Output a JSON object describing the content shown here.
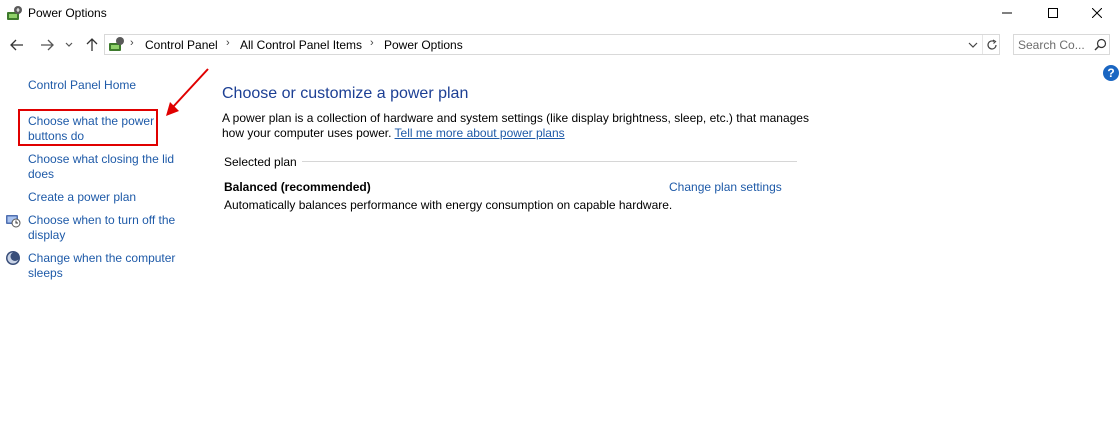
{
  "window": {
    "title": "Power Options",
    "app_icon": "power-options-icon"
  },
  "address_bar": {
    "crumbs": [
      "Control Panel",
      "All Control Panel Items",
      "Power Options"
    ]
  },
  "search": {
    "placeholder": "Search Co..."
  },
  "left_pane": {
    "home_link": "Control Panel Home",
    "items": [
      {
        "label": "Choose what the power buttons do",
        "icon": null
      },
      {
        "label": "Choose what closing the lid does",
        "icon": null
      },
      {
        "label": "Create a power plan",
        "icon": null
      },
      {
        "label": "Choose when to turn off the display",
        "icon": "display-timer-icon"
      },
      {
        "label": "Change when the computer sleeps",
        "icon": "sleep-moon-icon"
      }
    ]
  },
  "main": {
    "heading": "Choose or customize a power plan",
    "description": "A power plan is a collection of hardware and system settings (like display brightness, sleep, etc.) that manages how your computer uses power.",
    "learn_more_link": "Tell me more about power plans",
    "selected_plan_label": "Selected plan",
    "plan": {
      "name": "Balanced (recommended)",
      "change_link": "Change plan settings",
      "description": "Automatically balances performance with energy consumption on capable hardware."
    }
  },
  "annotation": {
    "highlight_color": "#e00000"
  },
  "colors": {
    "link": "#1e5aa8",
    "heading": "#1c3f94"
  }
}
